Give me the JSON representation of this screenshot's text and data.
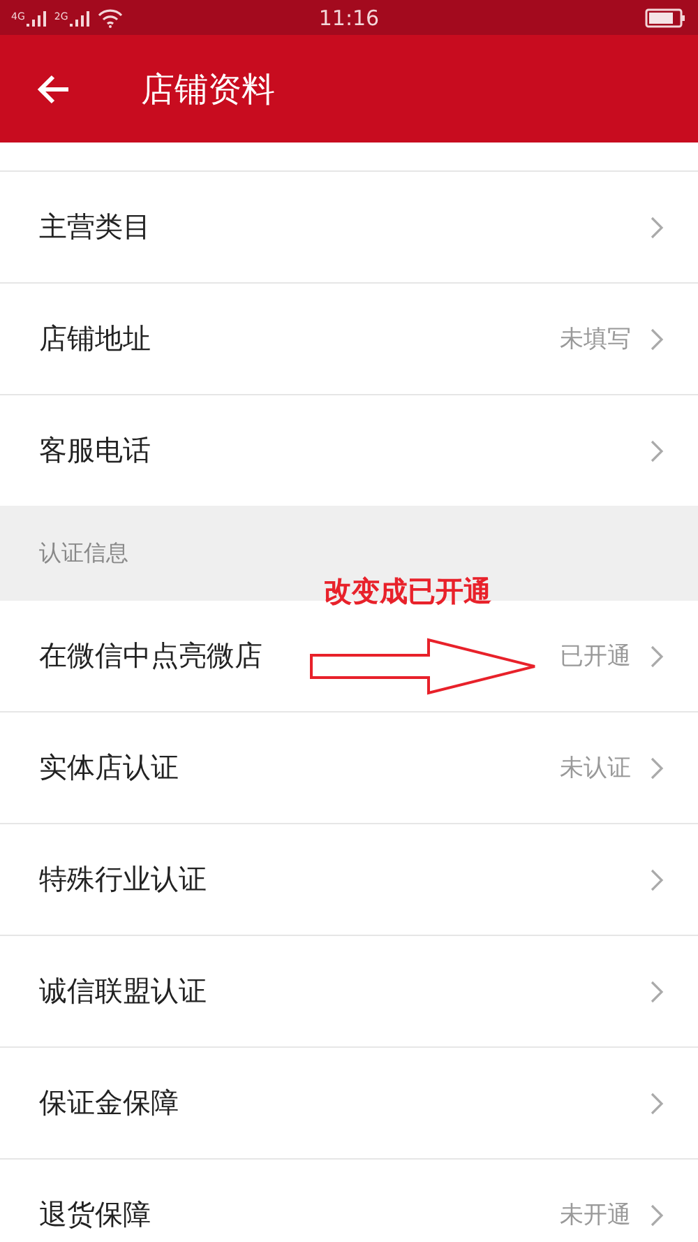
{
  "status_bar": {
    "networks": [
      "4G",
      "2G"
    ],
    "time": "11:16"
  },
  "header": {
    "title": "店铺资料"
  },
  "groups": [
    {
      "items": [
        {
          "label": "主营类目"
        },
        {
          "label": "店铺地址",
          "value": "未填写"
        },
        {
          "label": "客服电话"
        }
      ]
    },
    {
      "title": "认证信息",
      "items": [
        {
          "label": "在微信中点亮微店",
          "value": "已开通"
        },
        {
          "label": "实体店认证",
          "value": "未认证"
        },
        {
          "label": "特殊行业认证"
        },
        {
          "label": "诚信联盟认证"
        },
        {
          "label": "保证金保障"
        },
        {
          "label": "退货保障",
          "value": "未开通"
        }
      ]
    }
  ],
  "annotation": {
    "text": "改变成已开通"
  }
}
